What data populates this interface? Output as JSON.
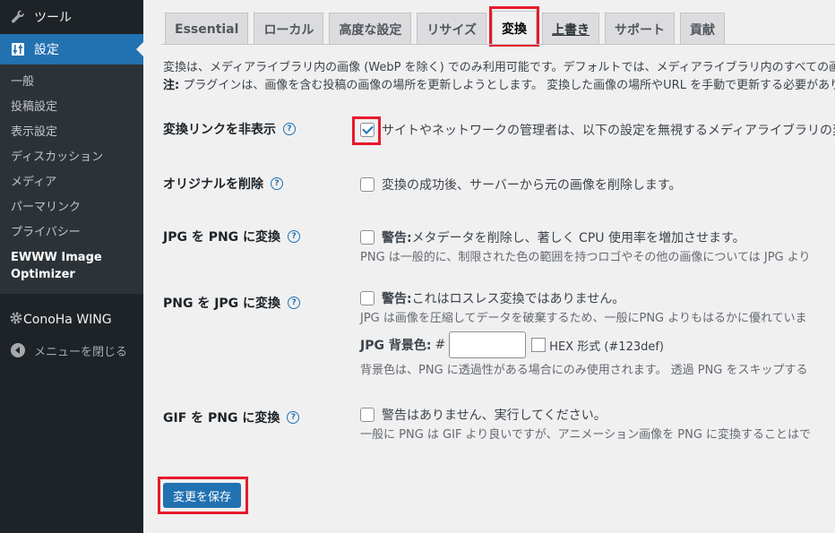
{
  "sidebar": {
    "tools_label": "ツール",
    "settings_label": "設定",
    "sub_items": [
      "一般",
      "投稿設定",
      "表示設定",
      "ディスカッション",
      "メディア",
      "パーマリンク",
      "プライバシー"
    ],
    "current_item": "EWWW Image Optimizer",
    "conoha_label": "ConoHa WING",
    "collapse_label": "メニューを閉じる"
  },
  "tabs": [
    {
      "label": "Essential"
    },
    {
      "label": "ローカル"
    },
    {
      "label": "高度な設定"
    },
    {
      "label": "リサイズ"
    },
    {
      "label": "変換"
    },
    {
      "label": "上書き"
    },
    {
      "label": "サポート"
    },
    {
      "label": "貢献"
    }
  ],
  "intro": {
    "line1": "変換は、メディアライブラリ内の画像 (WebP を除く) でのみ利用可能です。デフォルトでは、メディアライブラリ内のすべての画",
    "note_prefix": "注:",
    "line2": " プラグインは、画像を含む投稿の画像の場所を更新しようとします。 変換した画像の場所やURL を手動で更新する必要があり"
  },
  "settings": {
    "hide_links": {
      "label": "変換リンクを非表示",
      "text": "サイトやネットワークの管理者は、以下の設定を無視するメディアライブラリの変"
    },
    "delete_originals": {
      "label": "オリジナルを削除",
      "text": "変換の成功後、サーバーから元の画像を削除します。"
    },
    "jpg_to_png": {
      "label": "JPG を PNG に変換",
      "warn": "警告:",
      "text": " メタデータを削除し、著しく CPU 使用率を増加させます。",
      "desc": "PNG は一般的に、制限された色の範囲を持つロゴやその他の画像については JPG より"
    },
    "png_to_jpg": {
      "label": "PNG を JPG に変換",
      "warn": "警告:",
      "text": " これはロスレス変換ではありません。",
      "desc": "JPG は画像を圧縮してデータを破棄するため、一般にPNG よりもはるかに優れていま",
      "bg_label": "JPG 背景色:",
      "hash": "#",
      "bg_value": "",
      "hex_hint": "HEX 形式 (#123def)",
      "desc2": "背景色は、PNG に透過性がある場合にのみ使用されます。 透過 PNG をスキップする"
    },
    "gif_to_png": {
      "label": "GIF を PNG に変換",
      "text": "警告はありません、実行してください。",
      "desc": "一般に PNG は GIF より良いですが、アニメーション画像を PNG に変換することはで"
    }
  },
  "save_label": "変更を保存",
  "colors": {
    "accent": "#2271b1",
    "highlight": "#e8192c",
    "sidebar": "#1d2327"
  }
}
